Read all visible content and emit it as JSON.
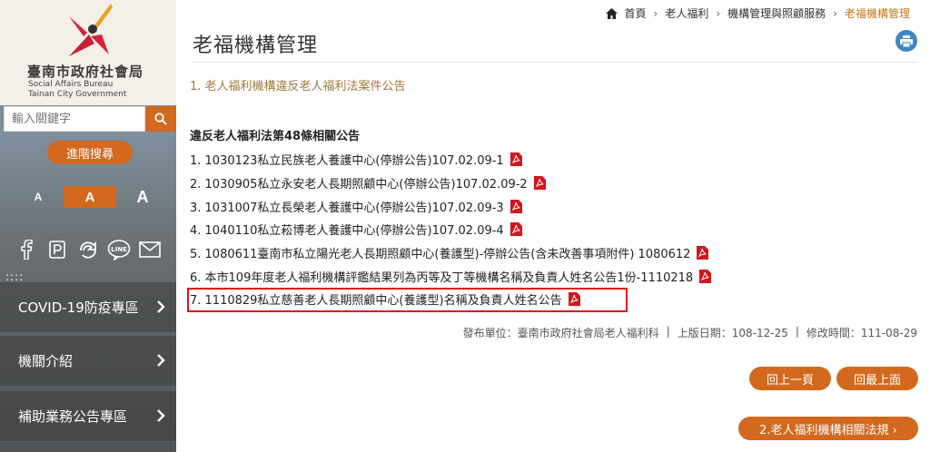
{
  "sidebar": {
    "logo": {
      "cn": "臺南市政府社會局",
      "en_line1": "Social Affairs Bureau",
      "en_line2": "Tainan City Government"
    },
    "search": {
      "placeholder": "輸入關鍵字"
    },
    "advanced_search_label": "進階搜尋",
    "font_sizes": [
      "A",
      "A",
      "A"
    ],
    "social_icons": [
      "facebook-icon",
      "plurk-icon",
      "share-icon",
      "line-icon",
      "mail-icon"
    ],
    "dots": "::::",
    "menu": [
      {
        "label": "COVID-19防疫專區"
      },
      {
        "label": "機關介紹"
      },
      {
        "label": "補助業務公告專區"
      }
    ]
  },
  "breadcrumb": {
    "items": [
      "首頁",
      "老人福利",
      "機構管理與照顧服務",
      "老福機構管理"
    ]
  },
  "page": {
    "title": "老福機構管理",
    "sub_link": "1. 老人福利機構違反老人福利法案件公告",
    "section_heading": "違反老人福利法第48條相關公告",
    "documents": [
      "1. 1030123私立民族老人養護中心(停辦公告)107.02.09-1",
      "2. 1030905私立永安老人長期照顧中心(停辦公告)107.02.09-2",
      "3. 1031007私立長榮老人養護中心(停辦公告)107.02.09-3",
      "4. 1040110私立菘博老人養護中心(停辦公告)107.02.09-4",
      "5. 1080611臺南市私立陽光老人長期照顧中心(養護型)-停辦公告(含未改善事項附件) 1080612",
      "6. 本市109年度老人福利機構評鑑結果列為丙等及丁等機構名稱及負責人姓名公告1份-1110218",
      "7. 1110829私立慈善老人長期照顧中心(養護型)名稱及負責人姓名公告"
    ],
    "meta": {
      "publisher": "發布單位：臺南市政府社會局老人福利科",
      "sep": "|",
      "online_date": "上版日期：108-12-25",
      "modified": "修改時間：111-08-29"
    },
    "buttons": {
      "prev": "回上一頁",
      "top": "回最上面",
      "next": "2.老人福利機構相關法規 ›"
    }
  },
  "colors": {
    "accent": "#d2691e",
    "link": "#a1783e",
    "highlight": "#e0101a",
    "print": "#3f86c2"
  }
}
